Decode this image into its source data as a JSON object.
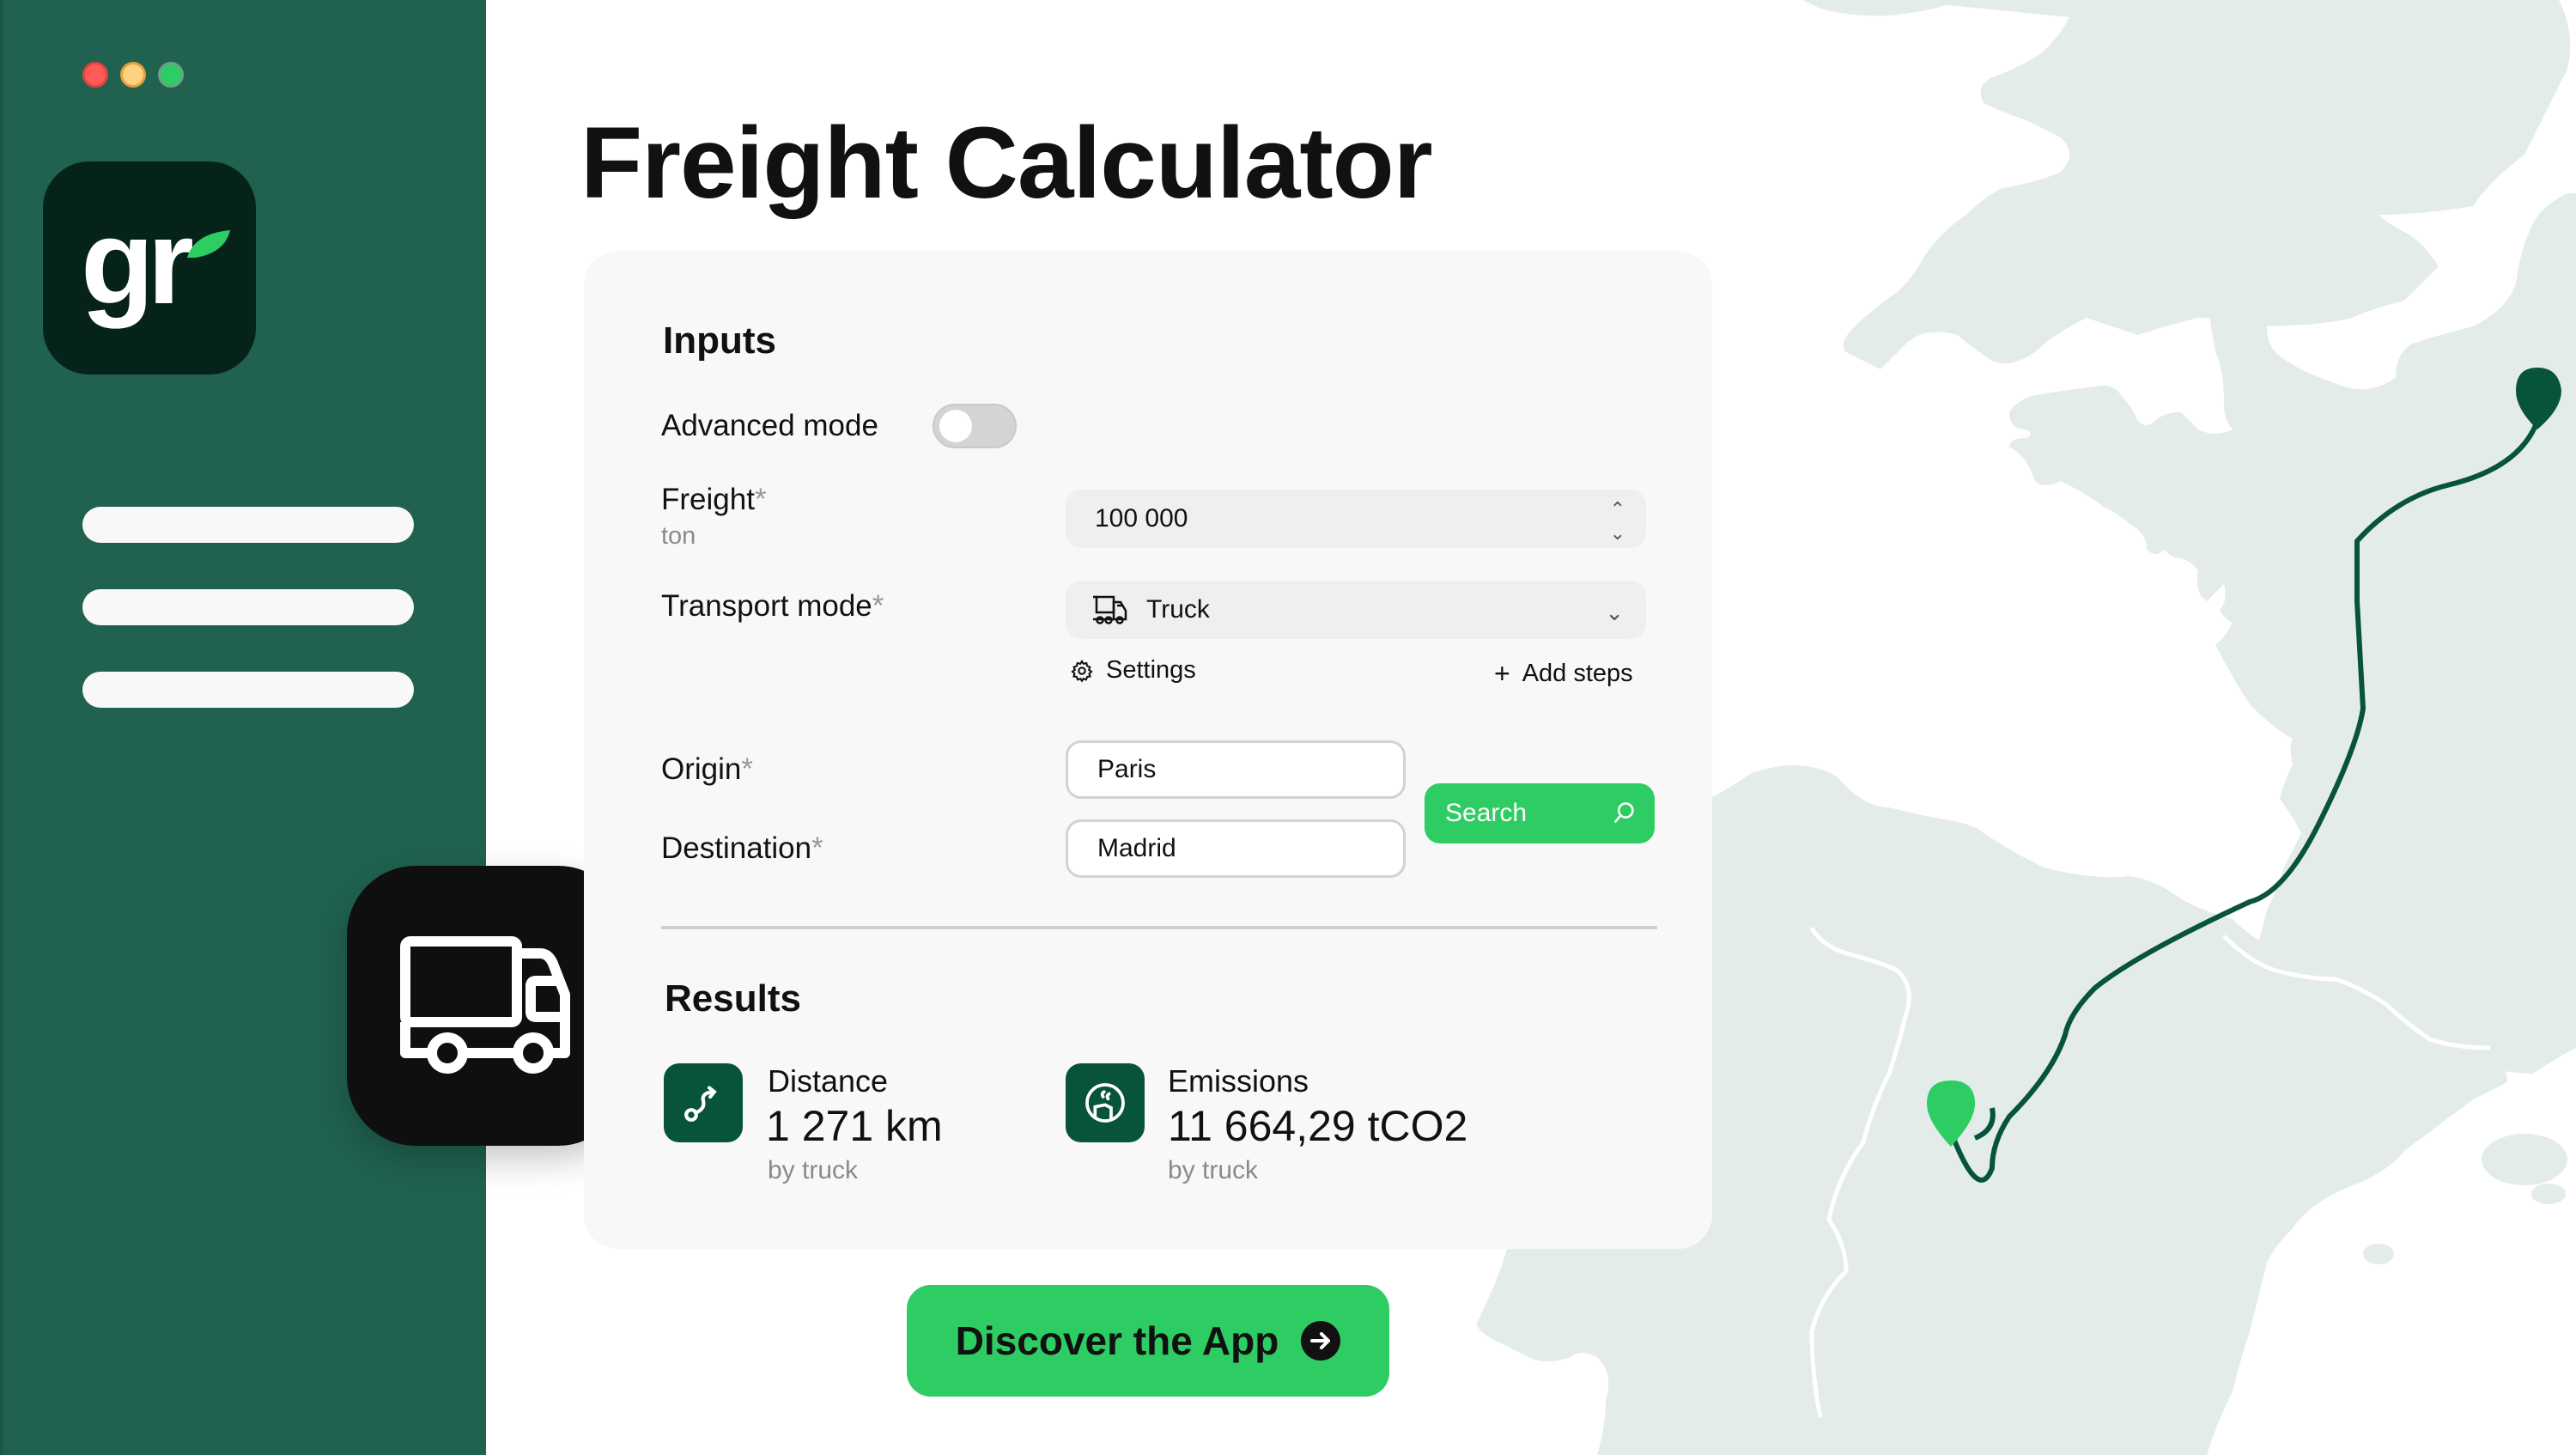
{
  "window": {
    "controls": [
      "close",
      "minimize",
      "maximize"
    ]
  },
  "brand": {
    "logo_text": "gr",
    "accent_color": "#2ecd63",
    "dark_green": "#07533c",
    "sidebar_color": "#206150"
  },
  "sidebar": {
    "items": [
      {
        "label": ""
      },
      {
        "label": ""
      },
      {
        "label": ""
      }
    ]
  },
  "page": {
    "title": "Freight Calculator"
  },
  "inputs": {
    "heading": "Inputs",
    "advanced_mode": {
      "label": "Advanced mode",
      "enabled": false
    },
    "freight": {
      "label": "Freight",
      "required_mark": "*",
      "unit": "ton",
      "value": "100 000"
    },
    "transport_mode": {
      "label": "Transport mode",
      "required_mark": "*",
      "value": "Truck",
      "icon": "truck-icon"
    },
    "settings_link": "Settings",
    "add_steps_link": "Add steps",
    "origin": {
      "label": "Origin",
      "required_mark": "*",
      "value": "Paris"
    },
    "destination": {
      "label": "Destination",
      "required_mark": "*",
      "value": "Madrid"
    },
    "search_button": "Search"
  },
  "results": {
    "heading": "Results",
    "distance": {
      "title": "Distance",
      "value": "1 271 km",
      "sub": "by truck",
      "icon": "route-icon"
    },
    "emissions": {
      "title": "Emissions",
      "value": "11 664,29 tCO2",
      "sub": "by truck",
      "icon": "emissions-icon"
    }
  },
  "cta": {
    "label": "Discover the App"
  },
  "map": {
    "route": {
      "from": "Paris",
      "to": "Madrid"
    },
    "land_color": "#e3ece9",
    "route_color": "#07533c"
  }
}
